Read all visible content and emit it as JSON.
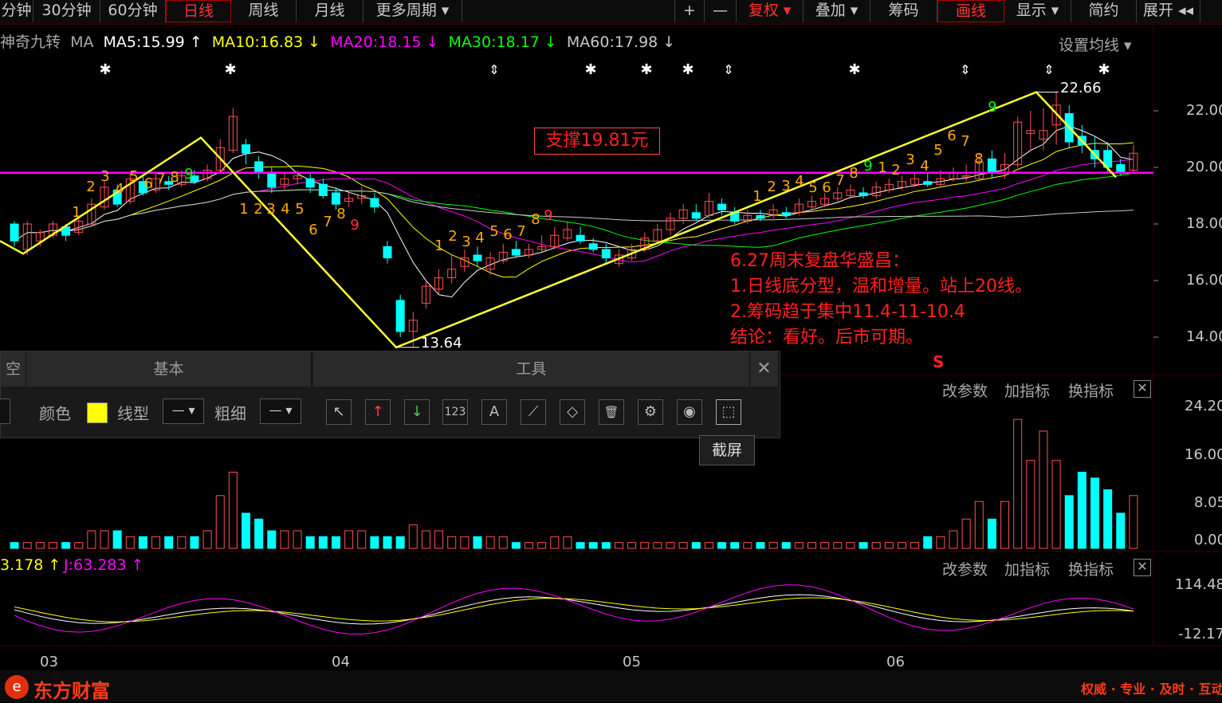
{
  "toolbar": {
    "items": [
      "分钟",
      "30分钟",
      "60分钟",
      "日线",
      "周线",
      "月线",
      "更多周期 ▾",
      "+",
      "—",
      "复权 ▾",
      "叠加 ▾",
      "筹码",
      "画线",
      "显示 ▾",
      "简约",
      "展开 ◂◂"
    ]
  },
  "ma_header": {
    "indicator": "神奇九转",
    "ma_label": "MA",
    "ma5": "MA5:15.99 ↑",
    "ma10": "MA10:16.83 ↓",
    "ma20": "MA20:18.15 ↓",
    "ma30": "MA30:18.17 ↓",
    "ma60": "MA60:17.98 ↓",
    "settings": "设置均线 ▾"
  },
  "colors": {
    "ma5": "#ffffff",
    "ma10": "#ffff00",
    "ma20": "#ff00ff",
    "ma30": "#00ff00",
    "ma60": "#c8c8c8",
    "up": "#ff5050",
    "down": "#00ffff",
    "trend_line": "#ffff33",
    "support_line": "#ff00ff",
    "annotation": "#ff2020"
  },
  "price_axis": [
    "22.00",
    "20.00",
    "18.00",
    "16.00",
    "14.00"
  ],
  "price_labels": {
    "high": "22.66",
    "low": "13.64"
  },
  "support_label": "支撑19.81元",
  "annotation_lines": [
    "6.27周末复盘华盛昌：",
    "1.日线底分型，温和增量。站上20线。",
    "2.筹码趋于集中11.4-11-10.4",
    "结论：看好。后市可期。"
  ],
  "s_marker": "S",
  "volume_axis": [
    "24.20",
    "16.00",
    "8.05",
    "0.00"
  ],
  "kdj_axis": [
    "114.48",
    "-12.17"
  ],
  "kdj_header": {
    "d": "3.178 ↑",
    "j": "J:63.283 ↑"
  },
  "sub_actions": [
    "改参数",
    "加指标",
    "换指标"
  ],
  "close_symbol": "✕",
  "date_axis": [
    "03",
    "04",
    "05",
    "06"
  ],
  "panel": {
    "tab_left": "空",
    "tab_basic": "基本",
    "tab_tools": "工具",
    "color_label": "颜色",
    "line_type_label": "线型",
    "thickness_label": "粗细",
    "select_value": "— ▾",
    "tools": [
      "cursor",
      "up-arrow",
      "down-arrow",
      "123",
      "A",
      "ruler",
      "eraser",
      "trash",
      "gear",
      "eye",
      "screenshot"
    ],
    "tool_glyphs": [
      "↖",
      "↑",
      "↓",
      "123",
      "A",
      "⟋",
      "◇",
      "🗑",
      "⚙",
      "◉",
      "⬚"
    ],
    "close": "✕",
    "swatch_color": "#ffff00"
  },
  "tooltip": "截屏",
  "brand": {
    "name": "东方财富",
    "slogan": "权威 · 专业 · 及时 · 互动"
  },
  "chart_data": {
    "type": "candlestick",
    "x_ticks": [
      "03",
      "04",
      "05",
      "06"
    ],
    "price_ylim": [
      13.0,
      23.2
    ],
    "candles": [
      {
        "o": 18.0,
        "c": 17.4,
        "h": 18.1,
        "l": 17.2
      },
      {
        "o": 17.1,
        "c": 18.0,
        "h": 18.1,
        "l": 16.9
      },
      {
        "o": 17.4,
        "c": 17.7,
        "h": 17.8,
        "l": 17.2
      },
      {
        "o": 17.6,
        "c": 18.0,
        "h": 18.1,
        "l": 17.5
      },
      {
        "o": 17.9,
        "c": 17.6,
        "h": 18.0,
        "l": 17.4
      },
      {
        "o": 17.7,
        "c": 18.1,
        "h": 18.3,
        "l": 17.6
      },
      {
        "o": 18.0,
        "c": 18.7,
        "h": 18.9,
        "l": 17.9
      },
      {
        "o": 18.6,
        "c": 19.3,
        "h": 19.5,
        "l": 18.5
      },
      {
        "o": 19.2,
        "c": 18.7,
        "h": 19.4,
        "l": 18.6
      },
      {
        "o": 18.8,
        "c": 19.6,
        "h": 19.8,
        "l": 18.7
      },
      {
        "o": 19.5,
        "c": 19.1,
        "h": 19.7,
        "l": 19.0
      },
      {
        "o": 19.2,
        "c": 19.6,
        "h": 19.8,
        "l": 19.1
      },
      {
        "o": 19.5,
        "c": 19.4,
        "h": 19.7,
        "l": 19.2
      },
      {
        "o": 19.4,
        "c": 19.7,
        "h": 19.9,
        "l": 19.3
      },
      {
        "o": 19.7,
        "c": 19.5,
        "h": 19.9,
        "l": 19.4
      },
      {
        "o": 19.6,
        "c": 19.9,
        "h": 20.1,
        "l": 19.5
      },
      {
        "o": 19.9,
        "c": 20.7,
        "h": 21.0,
        "l": 19.8
      },
      {
        "o": 20.6,
        "c": 21.8,
        "h": 22.1,
        "l": 20.5
      },
      {
        "o": 20.8,
        "c": 20.5,
        "h": 21.0,
        "l": 20.1
      },
      {
        "o": 20.2,
        "c": 19.8,
        "h": 20.4,
        "l": 19.6
      },
      {
        "o": 19.8,
        "c": 19.3,
        "h": 20.0,
        "l": 19.1
      },
      {
        "o": 19.4,
        "c": 19.6,
        "h": 19.8,
        "l": 19.2
      },
      {
        "o": 19.6,
        "c": 19.7,
        "h": 19.9,
        "l": 19.4
      },
      {
        "o": 19.6,
        "c": 19.3,
        "h": 19.8,
        "l": 19.1
      },
      {
        "o": 19.4,
        "c": 19.0,
        "h": 19.6,
        "l": 18.9
      },
      {
        "o": 19.1,
        "c": 18.7,
        "h": 19.3,
        "l": 18.5
      },
      {
        "o": 18.8,
        "c": 18.9,
        "h": 19.1,
        "l": 18.6
      },
      {
        "o": 18.9,
        "c": 19.0,
        "h": 19.3,
        "l": 18.7
      },
      {
        "o": 18.9,
        "c": 18.6,
        "h": 19.1,
        "l": 18.4
      },
      {
        "o": 17.2,
        "c": 16.8,
        "h": 17.4,
        "l": 16.6
      },
      {
        "o": 15.3,
        "c": 14.2,
        "h": 15.5,
        "l": 14.0
      },
      {
        "o": 14.2,
        "c": 14.6,
        "h": 14.9,
        "l": 13.64
      },
      {
        "o": 15.2,
        "c": 15.8,
        "h": 16.0,
        "l": 15.0
      },
      {
        "o": 15.7,
        "c": 16.1,
        "h": 16.4,
        "l": 15.5
      },
      {
        "o": 16.1,
        "c": 16.4,
        "h": 16.9,
        "l": 15.9
      },
      {
        "o": 16.5,
        "c": 16.8,
        "h": 17.1,
        "l": 16.3
      },
      {
        "o": 16.9,
        "c": 16.7,
        "h": 17.2,
        "l": 16.5
      },
      {
        "o": 16.4,
        "c": 16.8,
        "h": 17.0,
        "l": 16.2
      },
      {
        "o": 16.7,
        "c": 17.0,
        "h": 17.3,
        "l": 16.6
      },
      {
        "o": 17.1,
        "c": 16.9,
        "h": 17.4,
        "l": 16.8
      },
      {
        "o": 16.9,
        "c": 17.1,
        "h": 17.3,
        "l": 16.8
      },
      {
        "o": 17.1,
        "c": 17.2,
        "h": 17.6,
        "l": 17.0
      },
      {
        "o": 17.2,
        "c": 17.6,
        "h": 17.9,
        "l": 17.1
      },
      {
        "o": 17.5,
        "c": 17.8,
        "h": 18.1,
        "l": 17.4
      },
      {
        "o": 17.6,
        "c": 17.4,
        "h": 17.9,
        "l": 17.3
      },
      {
        "o": 17.3,
        "c": 17.1,
        "h": 17.5,
        "l": 17.0
      },
      {
        "o": 17.1,
        "c": 16.8,
        "h": 17.3,
        "l": 16.6
      },
      {
        "o": 16.6,
        "c": 16.9,
        "h": 17.1,
        "l": 16.5
      },
      {
        "o": 16.8,
        "c": 17.1,
        "h": 17.3,
        "l": 16.7
      },
      {
        "o": 17.1,
        "c": 17.5,
        "h": 17.7,
        "l": 17.0
      },
      {
        "o": 17.4,
        "c": 17.8,
        "h": 18.0,
        "l": 17.3
      },
      {
        "o": 17.8,
        "c": 18.2,
        "h": 18.4,
        "l": 17.6
      },
      {
        "o": 18.2,
        "c": 18.5,
        "h": 18.7,
        "l": 18.0
      },
      {
        "o": 18.4,
        "c": 18.2,
        "h": 18.7,
        "l": 18.1
      },
      {
        "o": 18.3,
        "c": 18.8,
        "h": 19.1,
        "l": 18.2
      },
      {
        "o": 18.7,
        "c": 18.5,
        "h": 18.9,
        "l": 18.3
      },
      {
        "o": 18.4,
        "c": 18.1,
        "h": 18.6,
        "l": 18.0
      },
      {
        "o": 18.1,
        "c": 18.3,
        "h": 18.5,
        "l": 18.0
      },
      {
        "o": 18.3,
        "c": 18.2,
        "h": 18.5,
        "l": 18.1
      },
      {
        "o": 18.3,
        "c": 18.5,
        "h": 18.7,
        "l": 18.2
      },
      {
        "o": 18.4,
        "c": 18.3,
        "h": 18.6,
        "l": 18.2
      },
      {
        "o": 18.4,
        "c": 18.7,
        "h": 18.9,
        "l": 18.3
      },
      {
        "o": 18.6,
        "c": 18.8,
        "h": 19.0,
        "l": 18.5
      },
      {
        "o": 18.7,
        "c": 18.9,
        "h": 19.1,
        "l": 18.6
      },
      {
        "o": 18.9,
        "c": 19.1,
        "h": 19.3,
        "l": 18.8
      },
      {
        "o": 19.0,
        "c": 19.2,
        "h": 19.4,
        "l": 18.9
      },
      {
        "o": 19.1,
        "c": 19.0,
        "h": 19.3,
        "l": 18.9
      },
      {
        "o": 19.0,
        "c": 19.3,
        "h": 19.5,
        "l": 18.9
      },
      {
        "o": 19.2,
        "c": 19.4,
        "h": 19.6,
        "l": 19.1
      },
      {
        "o": 19.3,
        "c": 19.5,
        "h": 19.7,
        "l": 19.2
      },
      {
        "o": 19.4,
        "c": 19.6,
        "h": 19.8,
        "l": 19.3
      },
      {
        "o": 19.5,
        "c": 19.4,
        "h": 19.8,
        "l": 19.3
      },
      {
        "o": 19.4,
        "c": 19.6,
        "h": 19.9,
        "l": 19.3
      },
      {
        "o": 19.6,
        "c": 19.8,
        "h": 20.0,
        "l": 19.5
      },
      {
        "o": 19.7,
        "c": 19.7,
        "h": 20.1,
        "l": 19.5
      },
      {
        "o": 19.6,
        "c": 20.2,
        "h": 20.5,
        "l": 19.5
      },
      {
        "o": 20.3,
        "c": 19.8,
        "h": 20.6,
        "l": 19.6
      },
      {
        "o": 19.8,
        "c": 20.1,
        "h": 20.5,
        "l": 19.6
      },
      {
        "o": 20.1,
        "c": 21.6,
        "h": 21.8,
        "l": 20.0
      },
      {
        "o": 21.2,
        "c": 21.3,
        "h": 22.0,
        "l": 20.6
      },
      {
        "o": 21.0,
        "c": 21.3,
        "h": 22.1,
        "l": 20.6
      },
      {
        "o": 21.5,
        "c": 22.2,
        "h": 22.66,
        "l": 20.8
      },
      {
        "o": 21.9,
        "c": 20.9,
        "h": 22.2,
        "l": 20.7
      },
      {
        "o": 21.1,
        "c": 20.8,
        "h": 21.5,
        "l": 20.5
      },
      {
        "o": 20.6,
        "c": 20.3,
        "h": 21.1,
        "l": 20.0
      },
      {
        "o": 20.6,
        "c": 20.0,
        "h": 20.9,
        "l": 19.8
      },
      {
        "o": 20.1,
        "c": 19.8,
        "h": 20.3,
        "l": 19.7
      },
      {
        "o": 19.9,
        "c": 20.5,
        "h": 20.8,
        "l": 19.8
      }
    ],
    "volume": [
      1,
      1,
      1,
      1,
      1,
      1,
      3,
      3,
      3,
      2,
      2,
      2,
      2,
      2,
      2,
      3,
      9,
      13,
      6,
      5,
      3,
      3,
      3,
      2,
      2,
      2,
      3,
      3,
      2,
      2,
      2,
      4,
      3,
      3,
      2,
      2,
      2,
      2,
      2,
      1,
      1,
      1,
      2,
      2,
      1,
      1,
      1,
      1,
      1,
      1,
      1,
      1,
      1,
      1,
      1,
      1,
      1,
      1,
      1,
      1,
      1,
      1,
      1,
      1,
      1,
      1,
      1,
      1,
      1,
      1,
      1,
      2,
      2,
      3,
      5,
      8,
      5,
      8,
      22,
      15,
      20,
      15,
      9,
      13,
      12,
      10,
      6,
      9
    ],
    "volume_ylim": [
      0,
      24.2
    ],
    "kdj_ylim": [
      -12.17,
      114.48
    ]
  }
}
